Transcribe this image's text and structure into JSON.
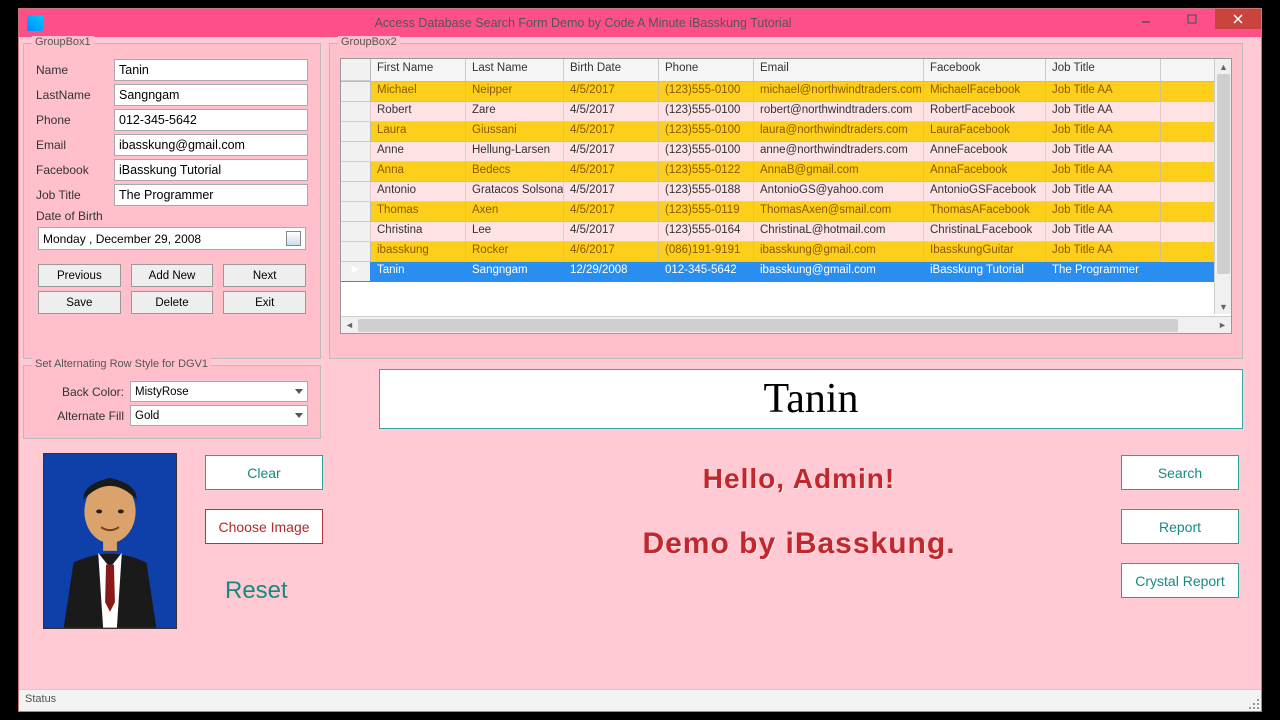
{
  "window": {
    "title": "Access Database Search Form Demo by Code A Minute iBasskung Tutorial"
  },
  "gb1": {
    "title": "GroupBox1",
    "labels": {
      "name": "Name",
      "lastname": "LastName",
      "phone": "Phone",
      "email": "Email",
      "facebook": "Facebook",
      "jobtitle": "Job Title",
      "dob": "Date of Birth"
    },
    "values": {
      "name": "Tanin",
      "lastname": "Sangngam",
      "phone": "012-345-5642",
      "email": "ibasskung@gmail.com",
      "facebook": "iBasskung Tutorial",
      "jobtitle": "The Programmer"
    },
    "date_display": "Monday   , December 29, 2008",
    "buttons": {
      "prev": "Previous",
      "add": "Add New",
      "next": "Next",
      "save": "Save",
      "delete": "Delete",
      "exit": "Exit"
    }
  },
  "gb2": {
    "title": "GroupBox2",
    "columns": [
      "First Name",
      "Last Name",
      "Birth Date",
      "Phone",
      "Email",
      "Facebook",
      "Job Title"
    ],
    "rows": [
      {
        "style": "gold",
        "cells": [
          "Michael",
          "Neipper",
          "4/5/2017",
          "(123)555-0100",
          "michael@northwindtraders.com",
          "MichaelFacebook",
          "Job Title AA"
        ]
      },
      {
        "style": "rose",
        "cells": [
          "Robert",
          "Zare",
          "4/5/2017",
          "(123)555-0100",
          "robert@northwindtraders.com",
          "RobertFacebook",
          "Job Title AA"
        ]
      },
      {
        "style": "gold",
        "cells": [
          "Laura",
          "Giussani",
          "4/5/2017",
          "(123)555-0100",
          "laura@northwindtraders.com",
          "LauraFacebook",
          "Job Title AA"
        ]
      },
      {
        "style": "rose",
        "cells": [
          "Anne",
          "Hellung-Larsen",
          "4/5/2017",
          "(123)555-0100",
          "anne@northwindtraders.com",
          "AnneFacebook",
          "Job Title AA"
        ]
      },
      {
        "style": "gold",
        "cells": [
          "Anna",
          "Bedecs",
          "4/5/2017",
          "(123)555-0122",
          "AnnaB@gmail.com",
          "AnnaFacebook",
          "Job Title AA"
        ]
      },
      {
        "style": "rose",
        "cells": [
          "Antonio",
          "Gratacos Solsona",
          "4/5/2017",
          "(123)555-0188",
          "AntonioGS@yahoo.com",
          "AntonioGSFacebook",
          "Job Title AA"
        ]
      },
      {
        "style": "gold",
        "cells": [
          "Thomas",
          "Axen",
          "4/5/2017",
          "(123)555-0119",
          "ThomasAxen@smail.com",
          "ThomasAFacebook",
          "Job Title AA"
        ]
      },
      {
        "style": "rose",
        "cells": [
          "Christina",
          "Lee",
          "4/5/2017",
          "(123)555-0164",
          "ChristinaL@hotmail.com",
          "ChristinaLFacebook",
          "Job Title AA"
        ]
      },
      {
        "style": "gold",
        "cells": [
          "ibasskung",
          "Rocker",
          "4/6/2017",
          "(086)191-9191",
          "ibasskung@gmail.com",
          "IbasskungGuitar",
          "Job Title AA"
        ]
      },
      {
        "style": "sel",
        "cells": [
          "Tanin",
          "Sangngam",
          "12/29/2008",
          "012-345-5642",
          "ibasskung@gmail.com",
          "iBasskung Tutorial",
          "The Programmer"
        ]
      }
    ]
  },
  "gb3": {
    "title": "Set Alternating Row Style for DGV1",
    "labels": {
      "back": "Back Color:",
      "alt": "Alternate Fill"
    },
    "values": {
      "back": "MistyRose",
      "alt": "Gold"
    }
  },
  "bigname": "Tanin",
  "hello": "Hello, Admin!",
  "demoby": "Demo by iBasskung.",
  "buttons": {
    "clear": "Clear",
    "choose": "Choose Image",
    "reset": "Reset",
    "search": "Search",
    "report": "Report",
    "crystal": "Crystal Report"
  },
  "status": "Status"
}
